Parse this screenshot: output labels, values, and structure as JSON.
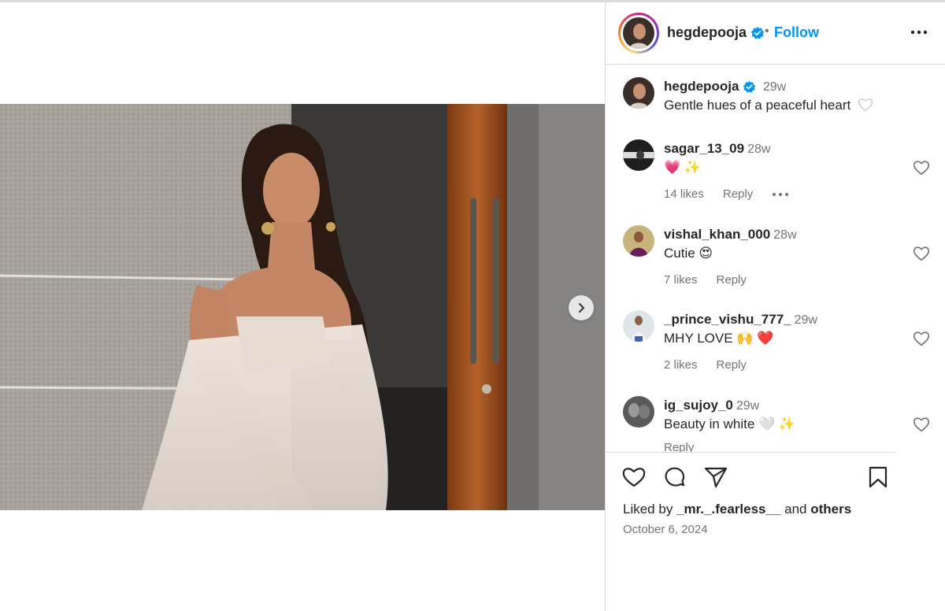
{
  "post": {
    "author": "hegdepooja",
    "follow_label": "Follow",
    "dot": "•",
    "caption": "Gentle hues of a peaceful heart",
    "caption_time": "29w",
    "liked_prefix": "Liked by",
    "liked_user": "_mr._.fearless__",
    "liked_and": "and",
    "liked_others": "others",
    "date": "October 6, 2024"
  },
  "comments": [
    {
      "user": "sagar_13_09",
      "time": "28w",
      "text": "💗 ✨",
      "likes": "14 likes",
      "reply": "Reply",
      "has_more": true
    },
    {
      "user": "vishal_khan_000",
      "time": "28w",
      "text": "Cutie 😍",
      "likes": "7 likes",
      "reply": "Reply"
    },
    {
      "user": "_prince_vishu_777_",
      "time": "29w",
      "text": "MHY LOVE 🙌 ❤️",
      "likes": "2 likes",
      "reply": "Reply"
    },
    {
      "user": "ig_sujoy_0",
      "time": "29w",
      "text": "Beauty in white 🤍 ✨",
      "reply": "Reply"
    }
  ],
  "icons": {
    "verified": "verified-badge-icon",
    "more": "more-options-icon",
    "next": "chevron-right-icon",
    "like": "heart-icon",
    "comment": "comment-icon",
    "share": "share-icon",
    "save": "bookmark-icon"
  },
  "colors": {
    "accent": "#0095f6",
    "text": "#262626",
    "secondary": "#737373",
    "border": "#dbdbdb"
  }
}
